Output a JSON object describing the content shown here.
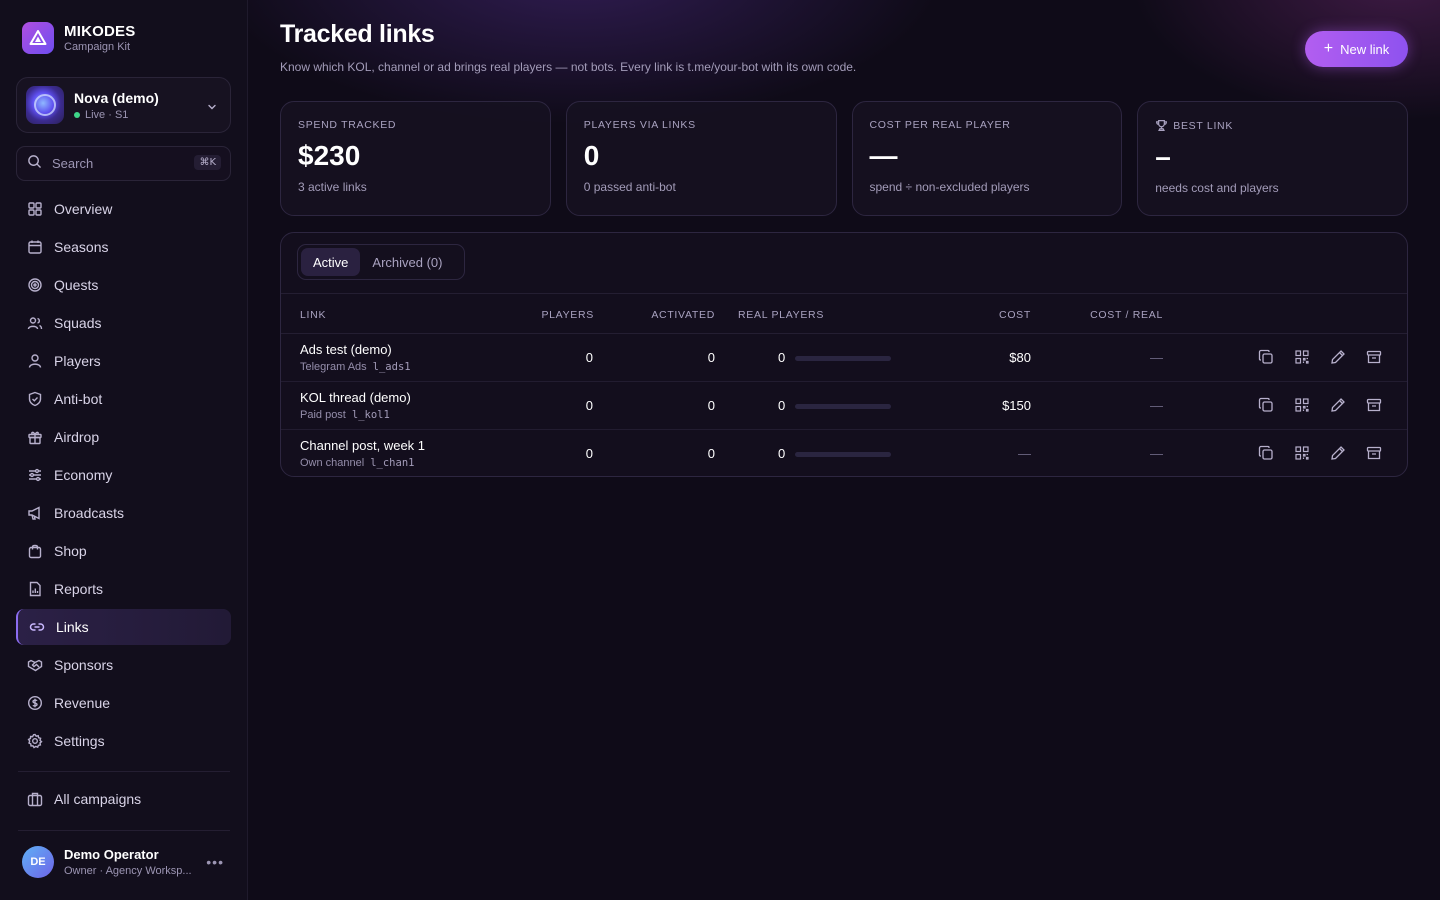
{
  "brand": {
    "name": "MIKODES",
    "subtitle": "Campaign Kit"
  },
  "campaign": {
    "name": "Nova (demo)",
    "status": "Live · S1"
  },
  "search": {
    "label": "Search",
    "shortcut": "⌘K"
  },
  "nav": {
    "items": [
      {
        "label": "Overview",
        "icon": "grid-icon"
      },
      {
        "label": "Seasons",
        "icon": "calendar-icon"
      },
      {
        "label": "Quests",
        "icon": "target-icon"
      },
      {
        "label": "Squads",
        "icon": "users-icon"
      },
      {
        "label": "Players",
        "icon": "user-icon"
      },
      {
        "label": "Anti-bot",
        "icon": "shield-icon"
      },
      {
        "label": "Airdrop",
        "icon": "gift-icon"
      },
      {
        "label": "Economy",
        "icon": "sliders-icon"
      },
      {
        "label": "Broadcasts",
        "icon": "megaphone-icon"
      },
      {
        "label": "Shop",
        "icon": "bag-icon"
      },
      {
        "label": "Reports",
        "icon": "report-icon"
      },
      {
        "label": "Links",
        "icon": "link-icon",
        "active": true
      },
      {
        "label": "Sponsors",
        "icon": "handshake-icon"
      },
      {
        "label": "Revenue",
        "icon": "dollar-icon"
      },
      {
        "label": "Settings",
        "icon": "gear-icon"
      }
    ],
    "all_campaigns": "All campaigns"
  },
  "user": {
    "initials": "DE",
    "name": "Demo Operator",
    "role": "Owner · Agency Worksp..."
  },
  "header": {
    "title": "Tracked links",
    "subtitle": "Know which KOL, channel or ad brings real players — not bots. Every link is t.me/your-bot with its own code.",
    "new_button": "New link"
  },
  "stats": [
    {
      "label": "SPEND TRACKED",
      "value": "$230",
      "note": "3 active links"
    },
    {
      "label": "PLAYERS VIA LINKS",
      "value": "0",
      "note": "0 passed anti-bot"
    },
    {
      "label": "COST PER REAL PLAYER",
      "value": "—",
      "note": "spend ÷ non-excluded players"
    },
    {
      "label": "BEST LINK",
      "value": "–",
      "note": "needs cost and players",
      "icon": "trophy-icon"
    }
  ],
  "tabs": {
    "active": "Active",
    "archived": "Archived (0)"
  },
  "table": {
    "columns": {
      "link": "LINK",
      "players": "PLAYERS",
      "activated": "ACTIVATED",
      "real": "REAL PLAYERS",
      "cost": "COST",
      "cost_real": "COST / REAL"
    },
    "rows": [
      {
        "name": "Ads test (demo)",
        "source": "Telegram Ads",
        "code": "l_ads1",
        "players": "0",
        "activated": "0",
        "real": "0",
        "real_fraction": 0,
        "cost": "$80",
        "cost_real": "—"
      },
      {
        "name": "KOL thread (demo)",
        "source": "Paid post",
        "code": "l_kol1",
        "players": "0",
        "activated": "0",
        "real": "0",
        "real_fraction": 0,
        "cost": "$150",
        "cost_real": "—"
      },
      {
        "name": "Channel post, week 1",
        "source": "Own channel",
        "code": "l_chan1",
        "players": "0",
        "activated": "0",
        "real": "0",
        "real_fraction": 0,
        "cost": "—",
        "cost_real": "—"
      }
    ]
  },
  "colors": {
    "accent": "#8b6cf0",
    "button": "#b25ef0",
    "live": "#3fd68a",
    "bg": "#0f0b18"
  }
}
